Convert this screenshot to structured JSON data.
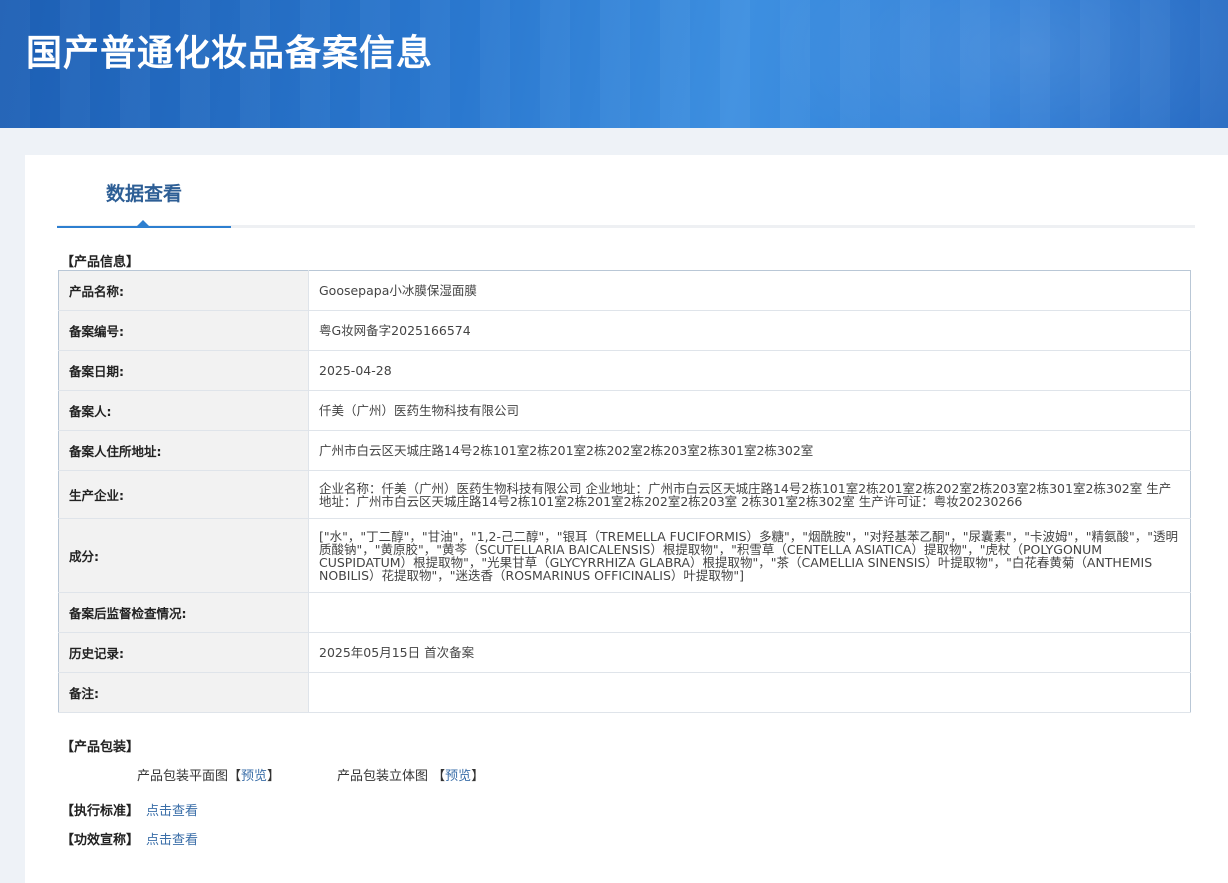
{
  "banner": {
    "title": "国产普通化妆品备案信息"
  },
  "tabs": [
    {
      "label": "数据查看"
    }
  ],
  "product_info": {
    "section_title": "【产品信息】",
    "rows": [
      {
        "label": "产品名称:",
        "value": "Goosepapa小冰膜保湿面膜"
      },
      {
        "label": "备案编号:",
        "value": "粤G妆网备字2025166574"
      },
      {
        "label": "备案日期:",
        "value": "2025-04-28"
      },
      {
        "label": "备案人:",
        "value": "仟美（广州）医药生物科技有限公司"
      },
      {
        "label": "备案人住所地址:",
        "value": "广州市白云区天城庄路14号2栋101室2栋201室2栋202室2栋203室2栋301室2栋302室"
      },
      {
        "label": "生产企业:",
        "value": "企业名称：仟美（广州）医药生物科技有限公司 企业地址：广州市白云区天城庄路14号2栋101室2栋201室2栋202室2栋203室2栋301室2栋302室 生产地址：广州市白云区天城庄路14号2栋101室2栋201室2栋202室2栋203室 2栋301室2栋302室 生产许可证：粤妆20230266"
      },
      {
        "label": "成分:",
        "value": "[\"水\"，\"丁二醇\"，\"甘油\"，\"1,2-己二醇\"，\"银耳（TREMELLA FUCIFORMIS）多糖\"，\"烟酰胺\"，\"对羟基苯乙酮\"，\"尿囊素\"，\"卡波姆\"，\"精氨酸\"，\"透明质酸钠\"，\"黄原胶\"，\"黄芩（SCUTELLARIA BAICALENSIS）根提取物\"，\"积雪草（CENTELLA ASIATICA）提取物\"，\"虎杖（POLYGONUM CUSPIDATUM）根提取物\"，\"光果甘草（GLYCYRRHIZA GLABRA）根提取物\"，\"茶（CAMELLIA SINENSIS）叶提取物\"，\"白花春黄菊（ANTHEMIS NOBILIS）花提取物\"，\"迷迭香（ROSMARINUS OFFICINALIS）叶提取物\"]"
      },
      {
        "label": "备案后监督检查情况:",
        "value": ""
      },
      {
        "label": "历史记录:",
        "value": "2025年05月15日 首次备案"
      },
      {
        "label": "备注:",
        "value": ""
      }
    ]
  },
  "packaging": {
    "section_title": "【产品包装】",
    "flat_label": "产品包装平面图",
    "flat_open": "【",
    "flat_link": "预览",
    "flat_close": "】",
    "stereo_label": "产品包装立体图",
    "stereo_open": "【",
    "stereo_link": "预览",
    "stereo_close": "】"
  },
  "standard": {
    "section_title": "【执行标准】",
    "link": "点击查看"
  },
  "efficacy": {
    "section_title": "【功效宣称】",
    "link": "点击查看"
  }
}
